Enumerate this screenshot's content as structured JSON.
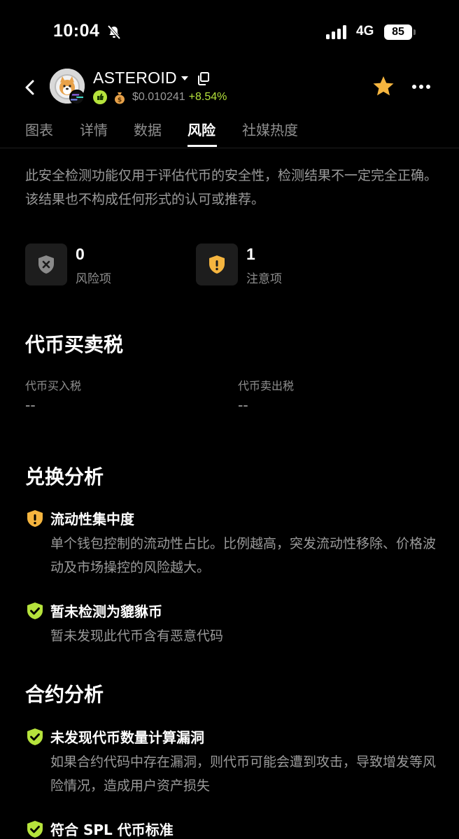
{
  "status_bar": {
    "time": "10:04",
    "network": "4G",
    "battery": "85"
  },
  "header": {
    "token_name": "ASTEROID",
    "price": "$0.010241",
    "change": "+8.54%",
    "colors": {
      "accent_green": "#b6e33c",
      "star": "#f5b53f",
      "warning": "#f5b53f"
    }
  },
  "tabs": [
    {
      "label": "图表"
    },
    {
      "label": "详情"
    },
    {
      "label": "数据"
    },
    {
      "label": "风险"
    },
    {
      "label": "社媒热度"
    }
  ],
  "active_tab": "风险",
  "disclaimer": "此安全检测功能仅用于评估代币的安全性，检测结果不一定完全正确。该结果也不构成任何形式的认可或推荐。",
  "summary": {
    "risk": {
      "count": "0",
      "label": "风险项",
      "icon": "shield-x-icon"
    },
    "caution": {
      "count": "1",
      "label": "注意项",
      "icon": "shield-warning-icon"
    }
  },
  "tax_section": {
    "title": "代币买卖税",
    "buy_label": "代币买入税",
    "buy_value": "--",
    "sell_label": "代币卖出税",
    "sell_value": "--"
  },
  "swap_section": {
    "title": "兑换分析",
    "items": [
      {
        "status": "warning",
        "icon": "shield-warning-icon",
        "title": "流动性集中度",
        "desc": "单个钱包控制的流动性占比。比例越高，突发流动性移除、价格波动及市场操控的风险越大。"
      },
      {
        "status": "ok",
        "icon": "shield-check-icon",
        "title": "暂未检测为貔貅币",
        "desc": "暂未发现此代币含有恶意代码"
      }
    ]
  },
  "contract_section": {
    "title": "合约分析",
    "items": [
      {
        "status": "ok",
        "icon": "shield-check-icon",
        "title": "未发现代币数量计算漏洞",
        "desc": "如果合约代码中存在漏洞，则代币可能会遭到攻击，导致增发等风险情况，造成用户资产损失"
      },
      {
        "status": "ok",
        "icon": "shield-check-icon",
        "title": "符合 SPL 代币标准",
        "desc": ""
      }
    ]
  }
}
